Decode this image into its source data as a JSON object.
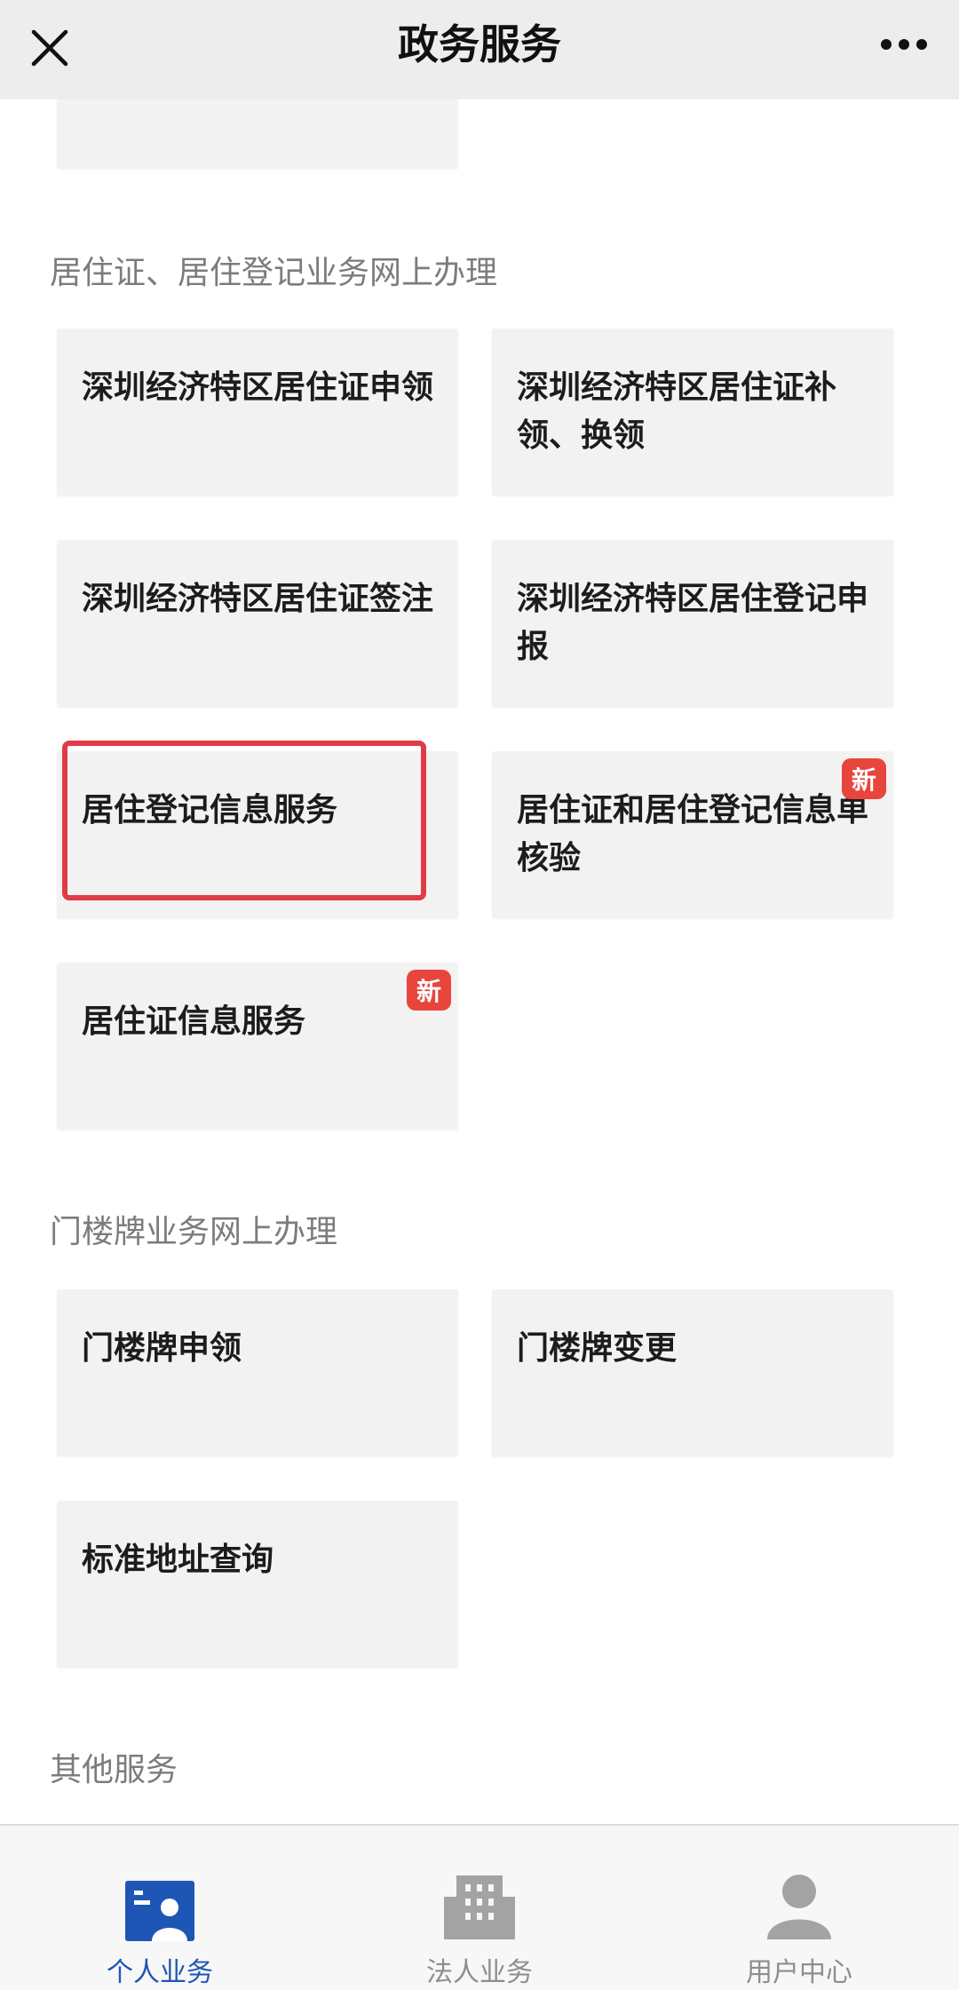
{
  "header": {
    "title": "政务服务",
    "close_icon": "close-icon",
    "more_icon": "more-icon"
  },
  "sections": [
    {
      "title": "居住证、居住登记业务网上办理",
      "tiles": [
        {
          "label": "深圳经济特区居住证申领"
        },
        {
          "label": "深圳经济特区居住证补领、换领"
        },
        {
          "label": "深圳经济特区居住证签注"
        },
        {
          "label": "深圳经济特区居住登记申报"
        },
        {
          "label": "居住登记信息服务",
          "highlighted": true
        },
        {
          "label": "居住证和居住登记信息单核验",
          "badge": "新"
        },
        {
          "label": "居住证信息服务",
          "badge": "新"
        }
      ]
    },
    {
      "title": "门楼牌业务网上办理",
      "tiles": [
        {
          "label": "门楼牌申领"
        },
        {
          "label": "门楼牌变更"
        },
        {
          "label": "标准地址查询"
        }
      ]
    },
    {
      "title": "其他服务"
    }
  ],
  "tabbar": [
    {
      "label": "个人业务",
      "icon": "person-card-icon",
      "active": true
    },
    {
      "label": "法人业务",
      "icon": "building-icon",
      "active": false
    },
    {
      "label": "用户中心",
      "icon": "user-icon",
      "active": false
    }
  ],
  "colors": {
    "accent": "#1e56b5",
    "badge": "#e8453c",
    "highlight_border": "#e23b48",
    "tile_bg": "#f2f2f2"
  }
}
